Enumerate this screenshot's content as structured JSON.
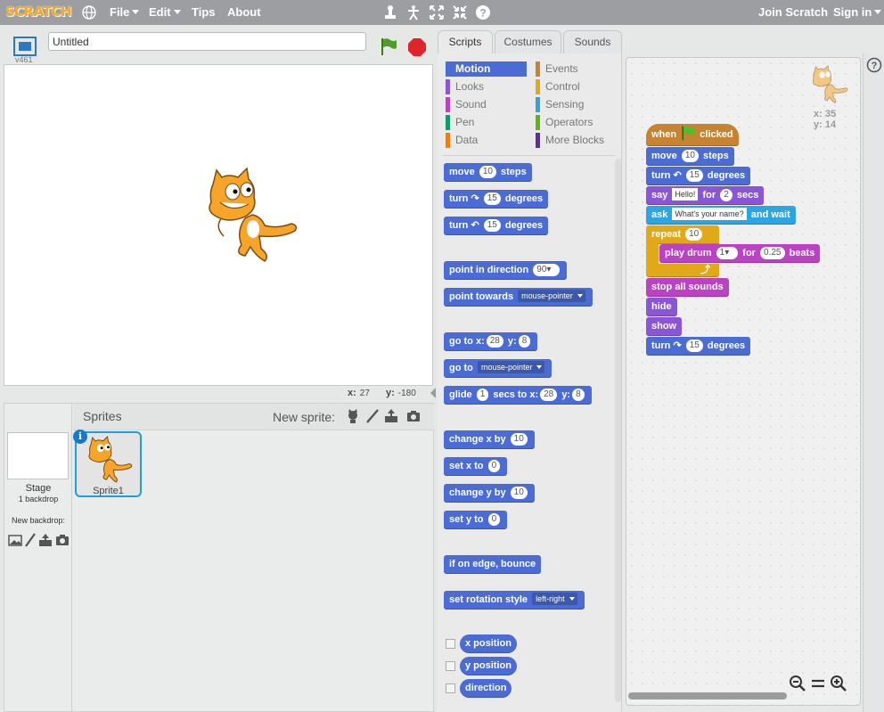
{
  "menu": {
    "logo": "SCRATCH",
    "file": "File",
    "edit": "Edit",
    "tips": "Tips",
    "about": "About",
    "join": "Join Scratch",
    "signin": "Sign in"
  },
  "stage_header": {
    "version": "v461",
    "title_value": "Untitled"
  },
  "stage_coords": {
    "x_label": "x:",
    "x_value": "27",
    "y_label": "y:",
    "y_value": "-180"
  },
  "sprites_panel": {
    "heading": "Sprites",
    "new_sprite_label": "New sprite:",
    "stage_label": "Stage",
    "backdrop_count": "1 backdrop",
    "new_backdrop_label": "New backdrop:",
    "sprite_name": "Sprite1",
    "info": "i"
  },
  "tabs": {
    "scripts": "Scripts",
    "costumes": "Costumes",
    "sounds": "Sounds"
  },
  "categories": {
    "motion": "Motion",
    "looks": "Looks",
    "sound": "Sound",
    "pen": "Pen",
    "data": "Data",
    "events": "Events",
    "control": "Control",
    "sensing": "Sensing",
    "operators": "Operators",
    "more": "More Blocks"
  },
  "palette": {
    "move": "move",
    "move_n": "10",
    "steps": "steps",
    "turn": "turn",
    "turn_n": "15",
    "degrees": "degrees",
    "point_dir": "point in direction",
    "dir_v": "90",
    "point_towards": "point towards",
    "mouse_pointer": "mouse-pointer",
    "go_to": "go to",
    "x_lbl": "x:",
    "y_lbl": "y:",
    "gx": "28",
    "gy": "8",
    "glide": "glide",
    "glide_n": "1",
    "secs_to": "secs to",
    "change_x": "change x by",
    "change_x_n": "10",
    "set_x": "set x to",
    "set_x_n": "0",
    "change_y": "change y by",
    "change_y_n": "10",
    "set_y": "set y to",
    "set_y_n": "0",
    "bounce": "if on edge, bounce",
    "rot_style": "set rotation style",
    "rot_v": "left-right",
    "xpos": "x position",
    "ypos": "y position",
    "direction": "direction"
  },
  "script_area": {
    "sprite_x": "x: 35",
    "sprite_y": "y: 14",
    "when": "when",
    "clicked": "clicked",
    "move": "move",
    "move_n": "10",
    "steps": "steps",
    "turn": "turn",
    "turn_n": "15",
    "degrees": "degrees",
    "say": "say",
    "say_text": "Hello!",
    "for": "for",
    "say_n": "2",
    "secs": "secs",
    "ask": "ask",
    "ask_text": "What's your name?",
    "and_wait": "and wait",
    "repeat": "repeat",
    "repeat_n": "10",
    "play_drum": "play drum",
    "drum_v": "1",
    "drum_for": "for",
    "beats_n": "0.25",
    "beats": "beats",
    "stop_sounds": "stop all sounds",
    "hide": "hide",
    "show": "show",
    "turn2_n": "15"
  }
}
